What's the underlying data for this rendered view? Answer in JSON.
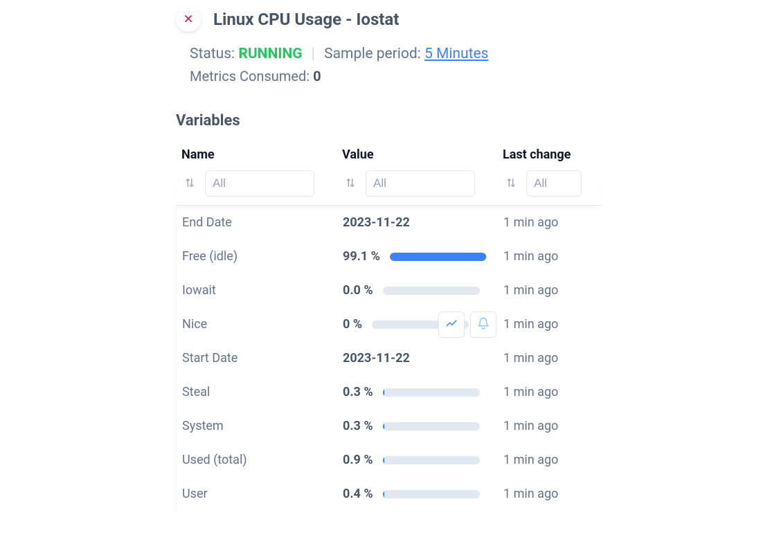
{
  "title": "Linux CPU Usage - Iostat",
  "status": {
    "label": "Status:",
    "value": "RUNNING",
    "sample_label": "Sample period:",
    "sample_value": "5 Minutes"
  },
  "metrics": {
    "label": "Metrics Consumed:",
    "value": "0"
  },
  "section_title": "Variables",
  "columns": {
    "name": "Name",
    "value": "Value",
    "last_change": "Last change"
  },
  "filters": {
    "placeholder": "All"
  },
  "rows": [
    {
      "name": "End Date",
      "value": "2023-11-22",
      "bar": null,
      "last": "1 min ago",
      "actions": false
    },
    {
      "name": "Free (idle)",
      "value": "99.1 %",
      "bar": 99.1,
      "last": "1 min ago",
      "actions": false
    },
    {
      "name": "Iowait",
      "value": "0.0 %",
      "bar": 0.0,
      "last": "1 min ago",
      "actions": false
    },
    {
      "name": "Nice",
      "value": "0 %",
      "bar": 0.0,
      "last": "1 min ago",
      "actions": true
    },
    {
      "name": "Start Date",
      "value": "2023-11-22",
      "bar": null,
      "last": "1 min ago",
      "actions": false
    },
    {
      "name": "Steal",
      "value": "0.3 %",
      "bar": 0.3,
      "last": "1 min ago",
      "actions": false
    },
    {
      "name": "System",
      "value": "0.3 %",
      "bar": 0.3,
      "last": "1 min ago",
      "actions": false
    },
    {
      "name": "Used (total)",
      "value": "0.9 %",
      "bar": 0.9,
      "last": "1 min ago",
      "actions": false
    },
    {
      "name": "User",
      "value": "0.4 %",
      "bar": 0.4,
      "last": "1 min ago",
      "actions": false
    }
  ]
}
